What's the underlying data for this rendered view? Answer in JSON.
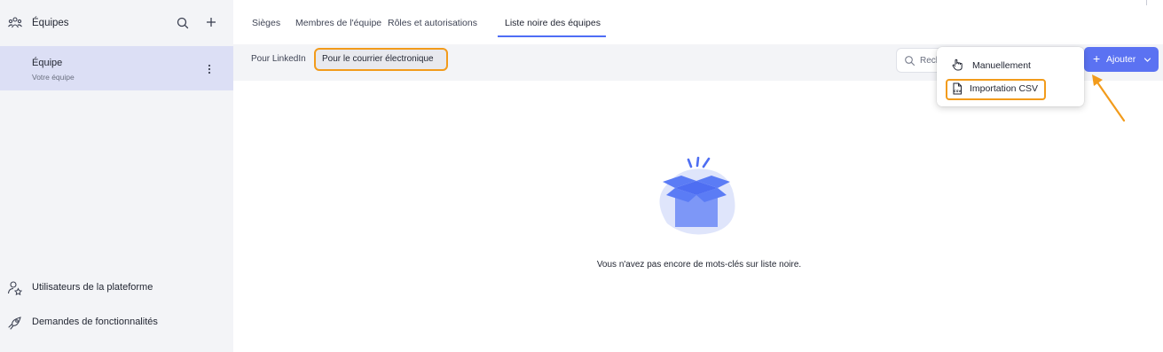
{
  "sidebar": {
    "header": {
      "title": "Équipes",
      "icon": "team-icon",
      "search_icon": "search-icon",
      "add_icon": "plus-icon"
    },
    "team": {
      "name": "Équipe",
      "subtitle": "Votre équipe",
      "menu_icon": "vertical-dots-icon"
    },
    "bottom_items": [
      {
        "label": "Utilisateurs de la plateforme",
        "icon": "user-star-icon"
      },
      {
        "label": "Demandes de fonctionnalités",
        "icon": "rocket-icon"
      }
    ]
  },
  "tabs": [
    {
      "label": "Sièges",
      "active": false
    },
    {
      "label": "Membres de l'équipe",
      "active": false
    },
    {
      "label": "Rôles et autorisations",
      "active": false
    },
    {
      "label": "Liste noire des équipes",
      "active": true
    }
  ],
  "subtabs": [
    {
      "label": "Pour LinkedIn",
      "active": false
    },
    {
      "label": "Pour le courrier électronique",
      "active": true
    }
  ],
  "search": {
    "value": "Rech",
    "icon": "search-icon"
  },
  "add_button": {
    "label": "Ajouter",
    "icon": "plus-icon",
    "chevron": "chevron-down-icon"
  },
  "dropdown": {
    "items": [
      {
        "label": "Manuellement",
        "icon": "hand-pointer-icon",
        "highlighted": false
      },
      {
        "label": "Importation CSV",
        "icon": "csv-file-icon",
        "highlighted": true
      }
    ]
  },
  "empty_state": {
    "message": "Vous n'avez pas encore de mots-clés sur liste noire.",
    "illustration": "open-box-icon"
  },
  "colors": {
    "accent": "#5b72f2",
    "highlight": "#f29b1b",
    "sidebar_bg": "#f3f4f7",
    "selected_bg": "#dcdff5",
    "illustration_blue": "#5b7cf5",
    "illustration_blob": "#dfe5fb"
  }
}
